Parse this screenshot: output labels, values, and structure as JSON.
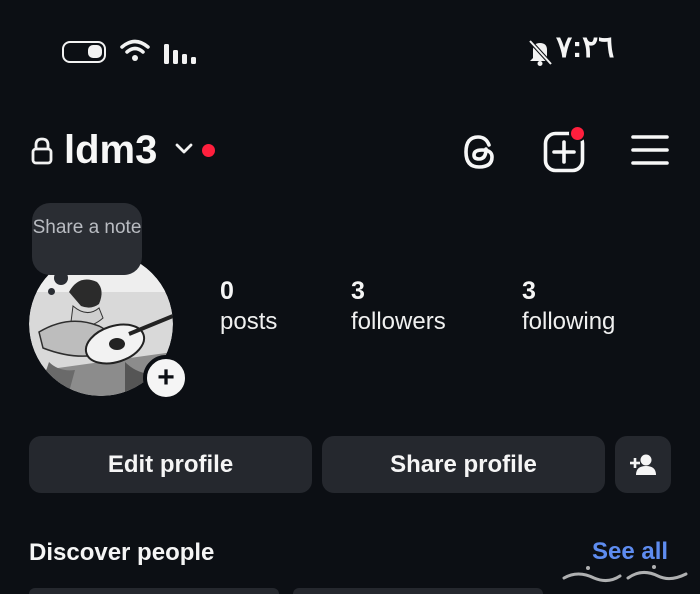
{
  "status_bar": {
    "time": "٧:٢٦",
    "icons": [
      "battery-icon",
      "wifi-icon",
      "signal-icon",
      "bell-slash-icon"
    ]
  },
  "header": {
    "username": "ldm3",
    "icons": [
      "lock-icon",
      "chevron-down-icon",
      "threads-icon",
      "create-icon",
      "menu-icon"
    ],
    "notification_color": "#ff1f3d"
  },
  "note": {
    "text": "Share a note"
  },
  "avatar": {
    "add_label": "+"
  },
  "stats": {
    "posts": {
      "count": "0",
      "label": "posts"
    },
    "followers": {
      "count": "3",
      "label": "followers"
    },
    "following": {
      "count": "3",
      "label": "following"
    }
  },
  "buttons": {
    "edit_profile": "Edit profile",
    "share_profile": "Share profile",
    "discover_icon": "add-person-icon"
  },
  "discover": {
    "title": "Discover people",
    "see_all": "See all",
    "accent": "#5e8cf0"
  }
}
